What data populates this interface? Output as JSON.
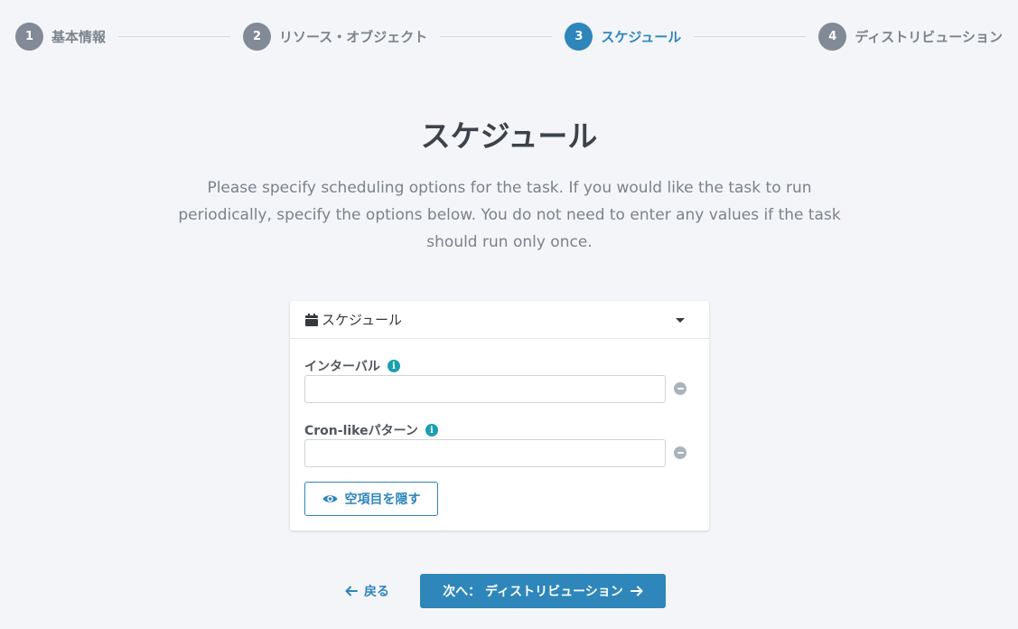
{
  "stepper": {
    "steps": [
      {
        "number": "1",
        "label": "基本情報"
      },
      {
        "number": "2",
        "label": "リソース・オブジェクト"
      },
      {
        "number": "3",
        "label": "スケジュール"
      },
      {
        "number": "4",
        "label": "ディストリビューション"
      }
    ],
    "active_step": 3
  },
  "page": {
    "title": "スケジュール",
    "description": "Please specify scheduling options for the task. If you would like the task to run periodically, specify the options below. You do not need to enter any values if the task should run only once."
  },
  "card": {
    "title": "スケジュール",
    "fields": [
      {
        "label": "インターバル",
        "value": "",
        "placeholder": ""
      },
      {
        "label": "Cron-likeパターン",
        "value": "",
        "placeholder": ""
      }
    ],
    "hide_button_label": "空項目を隠す"
  },
  "footer": {
    "back_label": "戻る",
    "next_label": "次へ： ディストリビューション"
  },
  "colors": {
    "primary": "#2e86bb",
    "info": "#1a9fb0",
    "step_inactive": "#818a96",
    "background": "#f4f5f9"
  }
}
